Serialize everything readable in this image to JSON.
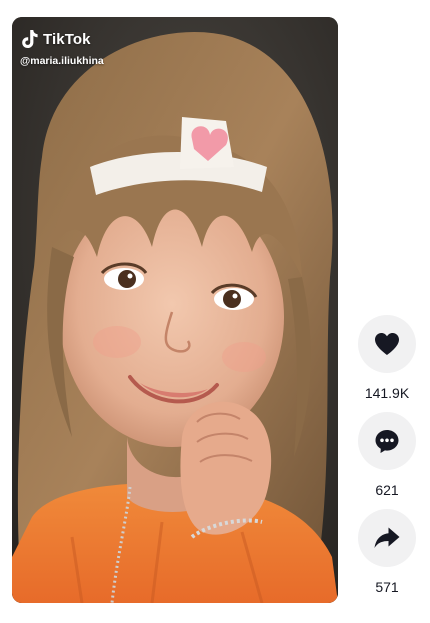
{
  "brand": {
    "name": "TikTok",
    "logo_icon": "tiktok-note-icon"
  },
  "video": {
    "author_handle": "@maria.iliukhina"
  },
  "actions": {
    "like": {
      "icon": "heart-icon",
      "count": "141.9K"
    },
    "comment": {
      "icon": "comment-bubble-icon",
      "count": "621"
    },
    "share": {
      "icon": "share-arrow-icon",
      "count": "571"
    }
  },
  "colors": {
    "action_bg": "#f1f1f2",
    "action_icon": "#161823",
    "count_text": "#161823",
    "overlay_text": "#ffffff"
  }
}
